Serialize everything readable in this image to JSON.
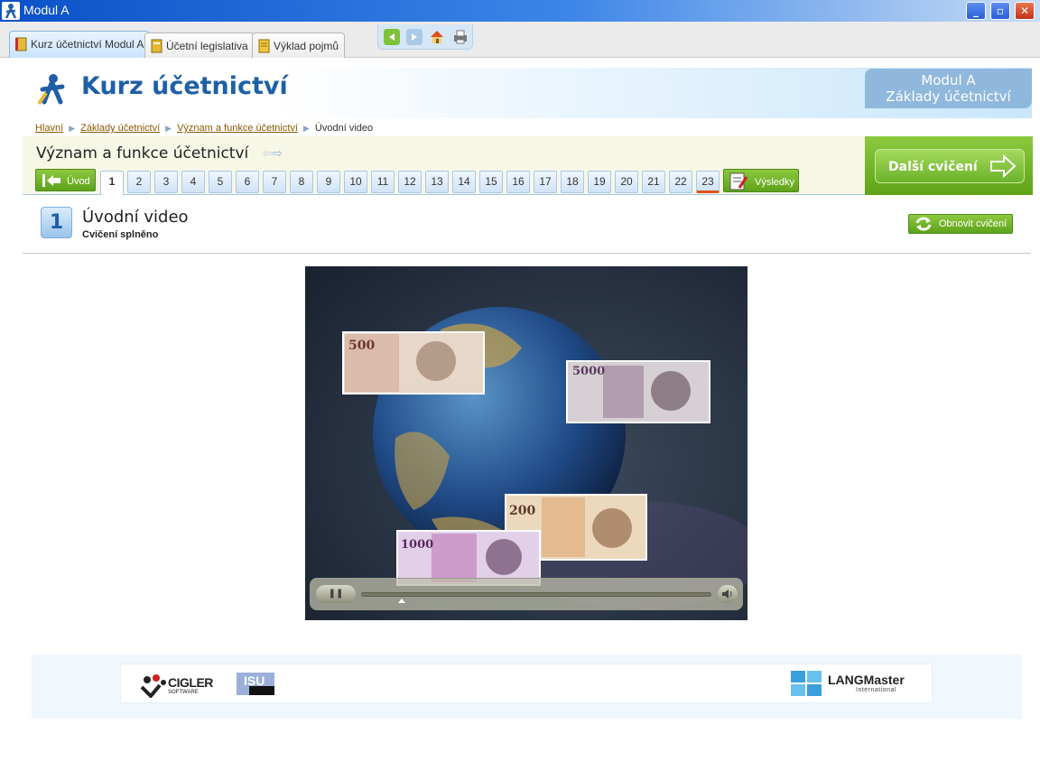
{
  "window": {
    "title": "Modul A",
    "minimize": "_",
    "restore": "▫",
    "close": "✕"
  },
  "tabs": [
    {
      "label": "Kurz účetnictví Modul A"
    },
    {
      "label": "Účetní legislativa"
    },
    {
      "label": "Výklad pojmů"
    }
  ],
  "header": {
    "title": "Kurz účetnictví",
    "module_line1": "Modul A",
    "module_line2": "Základy účetnictví"
  },
  "breadcrumb": {
    "items": [
      "Hlavní",
      "Základy účetnictví",
      "Význam a funkce účetnictví"
    ],
    "current": "Úvodní video"
  },
  "section": {
    "title": "Význam a funkce účetnictví",
    "next_label": "Další cvičení"
  },
  "nav": {
    "intro_label": "Úvod",
    "results_label": "Výsledky",
    "pages": [
      "1",
      "2",
      "3",
      "4",
      "5",
      "6",
      "7",
      "8",
      "9",
      "10",
      "11",
      "12",
      "13",
      "14",
      "15",
      "16",
      "17",
      "18",
      "19",
      "20",
      "21",
      "22",
      "23"
    ],
    "active_page": "1",
    "marked_page": "23"
  },
  "exercise": {
    "number": "1",
    "title": "Úvodní video",
    "status": "Cvičení splněno",
    "renew_label": "Obnovit cvičení"
  },
  "video": {
    "banknotes": [
      "500",
      "5000",
      "200",
      "1000"
    ]
  },
  "footer": {
    "cigler": "CIGLER",
    "cigler_sub": "SOFTWARE",
    "isu": "ISU",
    "langmaster": "LANGMaster",
    "langmaster_sub": "International"
  },
  "colors": {
    "brand_blue": "#1f5fa6",
    "green": "#6ab32a",
    "marker": "#e0521a"
  }
}
